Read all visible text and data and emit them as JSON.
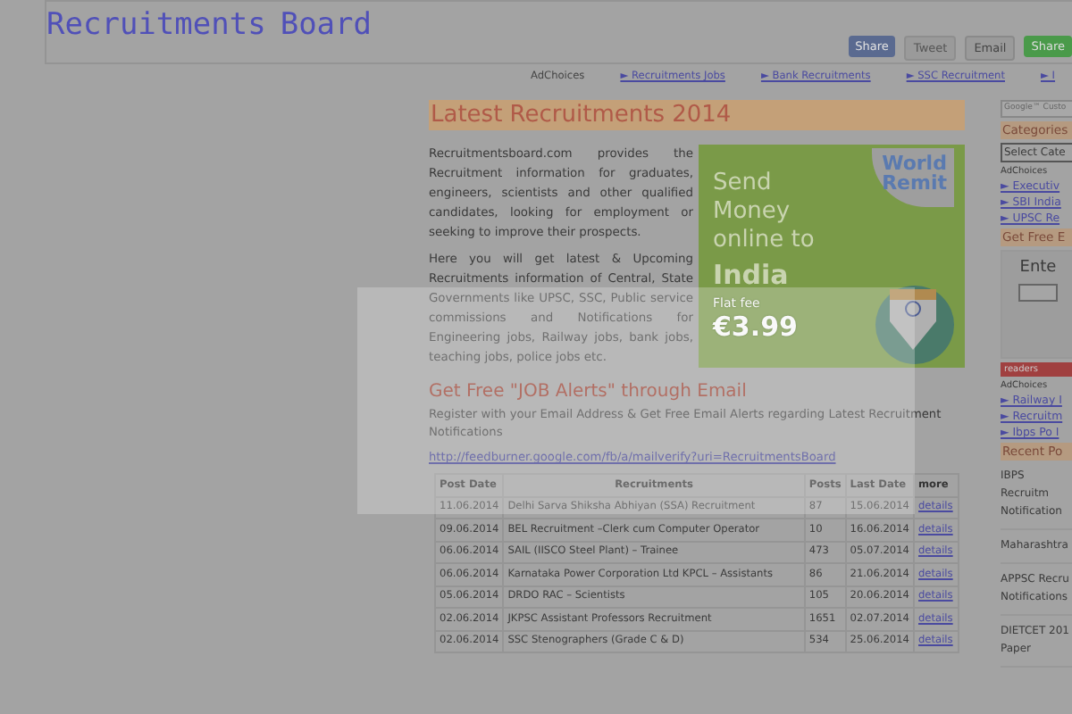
{
  "header": {
    "title": "Recruitments",
    "title_overlay": "Board",
    "share_buttons": [
      {
        "label": "Share",
        "kind": "facebook"
      },
      {
        "label": "Tweet",
        "kind": "twitter"
      },
      {
        "label": "Email",
        "kind": "email"
      },
      {
        "label": "Share",
        "kind": "sharethis"
      }
    ]
  },
  "nav": {
    "ad_choices": "AdChoices",
    "links": [
      "► Recruitments Jobs",
      "► Bank Recruitments",
      "► SSC Recruitment",
      "► I"
    ]
  },
  "main": {
    "title": "Latest Recruitments 2014",
    "intro": [
      "Recruitmentsboard.com provides the Recruitment information for graduates, engineers, scientists and other qualified candidates, looking for employment or seeking to improve their prospects.",
      "Here you will get latest & Upcoming Recruitments information of Central, State Governments like UPSC, SSC, Public service commissions and Notifications for Engineering jobs, Railway jobs, bank jobs, teaching jobs, police jobs etc."
    ],
    "ad": {
      "brand": [
        "World",
        "Remit"
      ],
      "headline": "Send Money online to",
      "country": "India",
      "fee_label": "Flat fee",
      "fee": "€3.99"
    },
    "alerts_heading": "Get Free \"JOB Alerts\" through Email",
    "alerts_text": "Register with your Email Address & Get Free Email Alerts regarding Latest Recruitment Notifications",
    "feed_link": "http://feedburner.google.com/fb/a/mailverify?uri=RecruitmentsBoard",
    "table": {
      "columns": [
        "Post Date",
        "Recruitments",
        "Posts",
        "Last Date",
        "more"
      ],
      "rows": [
        [
          "11.06.2014",
          "Delhi Sarva Shiksha Abhiyan (SSA) Recruitment",
          "87",
          "15.06.2014",
          "details"
        ],
        [
          "09.06.2014",
          "BEL Recruitment –Clerk cum Computer Operator",
          "10",
          "16.06.2014",
          "details"
        ],
        [
          "06.06.2014",
          "SAIL (IISCO Steel Plant) – Trainee",
          "473",
          "05.07.2014",
          "details"
        ],
        [
          "06.06.2014",
          "Karnataka Power Corporation Ltd KPCL – Assistants",
          "86",
          "21.06.2014",
          "details"
        ],
        [
          "05.06.2014",
          "DRDO RAC – Scientists",
          "105",
          "20.06.2014",
          "details"
        ],
        [
          "02.06.2014",
          "JKPSC Assistant Professors Recruitment",
          "1651",
          "02.07.2014",
          "details"
        ],
        [
          "02.06.2014",
          "SSC Stenographers (Grade C & D)",
          "534",
          "25.06.2014",
          "details"
        ]
      ]
    }
  },
  "sidebar": {
    "search_placeholder": "Google™ Custo",
    "categories_heading": "Categories",
    "category_select": "Select Cate",
    "ad_choices_1": "AdChoices",
    "links_1": [
      "► Executiv",
      "► SBI India",
      "► UPSC Re"
    ],
    "free_heading": "Get Free E",
    "subscribe_label": "Ente",
    "readers_badge": "readers",
    "ad_choices_2": "AdChoices",
    "links_2": [
      "► Railway I",
      "► Recruitm",
      "► Ibps Po I"
    ],
    "recent_heading": "Recent Po",
    "recent_posts": [
      "IBPS Recruitm Notification",
      "Maharashtra",
      "APPSC Recru Notifications",
      "DIETCET 201 Paper"
    ]
  }
}
